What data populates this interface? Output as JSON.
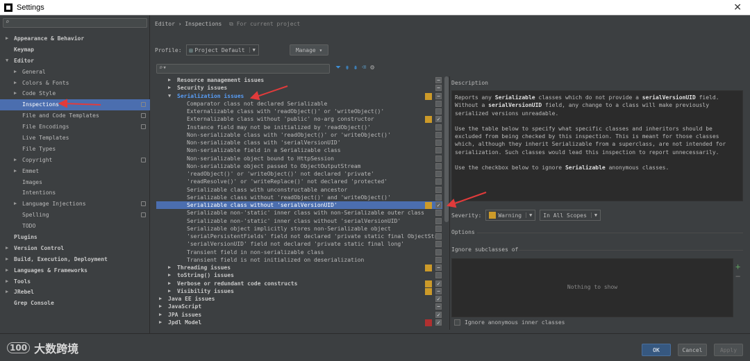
{
  "window": {
    "title": "Settings"
  },
  "sidebar": {
    "items": [
      {
        "label": "Appearance & Behavior",
        "indent": 0,
        "arrow": "▶",
        "bold": true
      },
      {
        "label": "Keymap",
        "indent": 0,
        "arrow": "",
        "bold": true
      },
      {
        "label": "Editor",
        "indent": 0,
        "arrow": "▼",
        "bold": true
      },
      {
        "label": "General",
        "indent": 1,
        "arrow": "▶"
      },
      {
        "label": "Colors & Fonts",
        "indent": 1,
        "arrow": "▶"
      },
      {
        "label": "Code Style",
        "indent": 1,
        "arrow": "▶"
      },
      {
        "label": "Inspections",
        "indent": 1,
        "arrow": "",
        "selected": true,
        "cfg": true
      },
      {
        "label": "File and Code Templates",
        "indent": 1,
        "arrow": "",
        "cfg": true
      },
      {
        "label": "File Encodings",
        "indent": 1,
        "arrow": "",
        "cfg": true
      },
      {
        "label": "Live Templates",
        "indent": 1,
        "arrow": ""
      },
      {
        "label": "File Types",
        "indent": 1,
        "arrow": ""
      },
      {
        "label": "Copyright",
        "indent": 1,
        "arrow": "▶",
        "cfg": true
      },
      {
        "label": "Emmet",
        "indent": 1,
        "arrow": "▶"
      },
      {
        "label": "Images",
        "indent": 1,
        "arrow": ""
      },
      {
        "label": "Intentions",
        "indent": 1,
        "arrow": ""
      },
      {
        "label": "Language Injections",
        "indent": 1,
        "arrow": "▶",
        "cfg": true
      },
      {
        "label": "Spelling",
        "indent": 1,
        "arrow": "",
        "cfg": true
      },
      {
        "label": "TODO",
        "indent": 1,
        "arrow": ""
      },
      {
        "label": "Plugins",
        "indent": 0,
        "arrow": "",
        "bold": true
      },
      {
        "label": "Version Control",
        "indent": 0,
        "arrow": "▶",
        "bold": true
      },
      {
        "label": "Build, Execution, Deployment",
        "indent": 0,
        "arrow": "▶",
        "bold": true
      },
      {
        "label": "Languages & Frameworks",
        "indent": 0,
        "arrow": "▶",
        "bold": true
      },
      {
        "label": "Tools",
        "indent": 0,
        "arrow": "▶",
        "bold": true
      },
      {
        "label": "JRebel",
        "indent": 0,
        "arrow": "▶",
        "bold": true
      },
      {
        "label": "Grep Console",
        "indent": 0,
        "arrow": "",
        "bold": true
      }
    ]
  },
  "breadcrumb": {
    "path": "Editor › Inspections",
    "project_note": "For current project"
  },
  "profile": {
    "label": "Profile:",
    "value": "Project Default",
    "manage": "Manage ▾"
  },
  "inspections": [
    {
      "label": "Resource management issues",
      "level": 1,
      "arrow": "▶",
      "bold": true,
      "sev": "",
      "check": "partial"
    },
    {
      "label": "Security issues",
      "level": 1,
      "arrow": "▶",
      "bold": true,
      "sev": "",
      "check": "partial"
    },
    {
      "label": "Serialization issues",
      "level": 1,
      "arrow": "▼",
      "bold": true,
      "blue": true,
      "sev": "#cc9a29",
      "check": "partial"
    },
    {
      "label": "Comparator class not declared Serializable",
      "level": 2,
      "sev": "",
      "check": "off"
    },
    {
      "label": "Externalizable class with 'readObject()' or 'writeObject()'",
      "level": 2,
      "sev": "",
      "check": "off"
    },
    {
      "label": "Externalizable class without 'public' no-arg constructor",
      "level": 2,
      "sev": "#cc9a29",
      "check": "on"
    },
    {
      "label": "Instance field may not be initialized by 'readObject()'",
      "level": 2,
      "sev": "",
      "check": "off"
    },
    {
      "label": "Non-serializable class with 'readObject()' or 'writeObject()'",
      "level": 2,
      "sev": "",
      "check": "off"
    },
    {
      "label": "Non-serializable class with 'serialVersionUID'",
      "level": 2,
      "sev": "",
      "check": "off"
    },
    {
      "label": "Non-serializable field in a Serializable class",
      "level": 2,
      "sev": "",
      "check": "off"
    },
    {
      "label": "Non-serializable object bound to HttpSession",
      "level": 2,
      "sev": "",
      "check": "off"
    },
    {
      "label": "Non-serializable object passed to ObjectOutputStream",
      "level": 2,
      "sev": "",
      "check": "off"
    },
    {
      "label": "'readObject()' or 'writeObject()' not declared 'private'",
      "level": 2,
      "sev": "",
      "check": "off"
    },
    {
      "label": "'readResolve()' or 'writeReplace()' not declared 'protected'",
      "level": 2,
      "sev": "",
      "check": "off"
    },
    {
      "label": "Serializable class with unconstructable ancestor",
      "level": 2,
      "sev": "",
      "check": "off"
    },
    {
      "label": "Serializable class without 'readObject()' and 'writeObject()'",
      "level": 2,
      "sev": "",
      "check": "off"
    },
    {
      "label": "Serializable class without 'serialVersionUID'",
      "level": 2,
      "sev": "#cc9a29",
      "check": "on",
      "selected": true
    },
    {
      "label": "Serializable non-'static' inner class with non-Serializable outer class",
      "level": 2,
      "sev": "",
      "check": "off"
    },
    {
      "label": "Serializable non-'static' inner class without 'serialVersionUID'",
      "level": 2,
      "sev": "",
      "check": "off"
    },
    {
      "label": "Serializable object implicitly stores non-Serializable object",
      "level": 2,
      "sev": "",
      "check": "off"
    },
    {
      "label": "'serialPersistentFields' field not declared 'private static final ObjectStr",
      "level": 2,
      "sev": "",
      "check": "off"
    },
    {
      "label": "'serialVersionUID' field not declared 'private static final long'",
      "level": 2,
      "sev": "",
      "check": "off"
    },
    {
      "label": "Transient field in non-serializable class",
      "level": 2,
      "sev": "",
      "check": "off"
    },
    {
      "label": "Transient field is not initialized on deserialization",
      "level": 2,
      "sev": "",
      "check": "off"
    },
    {
      "label": "Threading issues",
      "level": 1,
      "arrow": "▶",
      "bold": true,
      "sev": "#cc9a29",
      "check": "partial"
    },
    {
      "label": "toString() issues",
      "level": 1,
      "arrow": "▶",
      "bold": true,
      "sev": "",
      "check": "off"
    },
    {
      "label": "Verbose or redundant code constructs",
      "level": 1,
      "arrow": "▶",
      "bold": true,
      "sev": "#cc9a29",
      "check": "on"
    },
    {
      "label": "Visibility issues",
      "level": 1,
      "arrow": "▶",
      "bold": true,
      "sev": "#cc9a29",
      "check": "partial"
    },
    {
      "label": "Java EE issues",
      "level": 0,
      "arrow": "▶",
      "bold": true,
      "sev": "",
      "check": "on"
    },
    {
      "label": "JavaScript",
      "level": 0,
      "arrow": "▶",
      "bold": true,
      "sev": "",
      "check": "partial"
    },
    {
      "label": "JPA issues",
      "level": 0,
      "arrow": "▶",
      "bold": true,
      "sev": "",
      "check": "on"
    },
    {
      "label": "Jpdl Model",
      "level": 0,
      "arrow": "▶",
      "bold": true,
      "sev": "#b03030",
      "check": "on"
    }
  ],
  "description": {
    "title": "Description",
    "p1": "Reports any Serializable classes which do not provide a serialVersionUID field. Without a serialVersionUID field, any change to a class will make previously serialized versions unreadable.",
    "p2": "Use the table below to specify what specific classes and inheritors should be excluded from being checked by this inspection. This is meant for those classes which, although they inherit Serializable from a superclass, are not intended for serialization. Such classes would lead this inspection to report unnecessarily.",
    "p3": "Use the checkbox below to ignore Serializable anonymous classes."
  },
  "severity": {
    "label": "Severity:",
    "value": "Warning",
    "scope": "In All Scopes",
    "color": "#cc9a29"
  },
  "options": {
    "title": "Options",
    "subclasses_title": "Ignore subclasses of",
    "empty": "Nothing to show",
    "anon_label": "Ignore anonymous inner classes"
  },
  "footer": {
    "brand": "大数跨境",
    "logo": "100",
    "ok": "OK",
    "cancel": "Cancel",
    "apply": "Apply"
  }
}
